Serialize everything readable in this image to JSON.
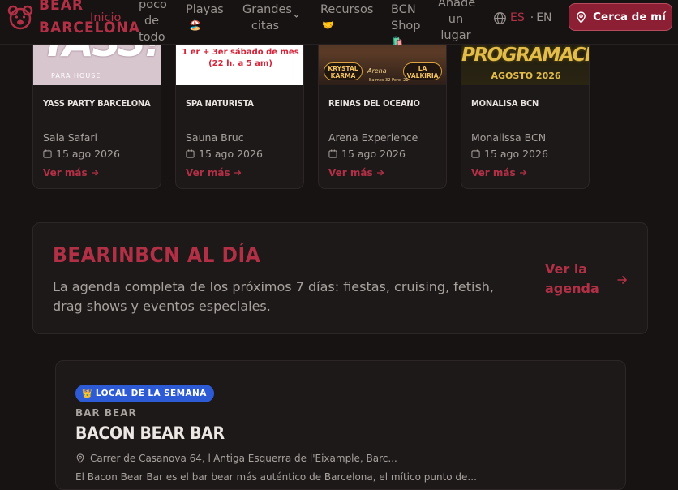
{
  "header": {
    "logo_text_line1": "BEAR",
    "logo_text_line2": "BARCELONA",
    "nav": {
      "inicio": "Inicio",
      "poco_line1": "poco",
      "poco_line2": "de",
      "poco_line3": "todo",
      "playas": "Playas",
      "playas_emoji": "🏖️",
      "grandes_line1": "Grandes",
      "grandes_line2": "citas",
      "recursos": "Recursos",
      "recursos_emoji": "🤝",
      "bcn_shop_line1": "BCN",
      "bcn_shop_line2": "Shop",
      "bcn_shop_emoji": "🛍️",
      "anade_line1": "Añade",
      "anade_line2": "un",
      "anade_line3": "lugar"
    },
    "lang_es": "ES",
    "lang_sep": "·",
    "lang_en": "EN",
    "near_me": "Cerca de mí"
  },
  "cards": [
    {
      "title": "YASS PARTY BARCELONA",
      "venue": "Sala Safari",
      "date": "15 ago 2026",
      "link": "Ver más",
      "img_big": "YASS!",
      "img_small": "PARA HOUSE"
    },
    {
      "title": "SPA NATURISTA",
      "venue": "Sauna Bruc",
      "date": "15 ago 2026",
      "link": "Ver más",
      "img_line1": "1 er + 3er sábado de mes",
      "img_line2": "(22 h. a 5 am)"
    },
    {
      "title": "REINAS DEL OCEANO",
      "venue": "Arena Experience",
      "date": "15 ago 2026",
      "link": "Ver más",
      "img_left": "KRYSTAL KARMA",
      "img_right": "LA VALKIRIA",
      "img_mid": "Arena",
      "img_addr": "Balmes 32 Pere, 21"
    },
    {
      "title": "MONALISA BCN",
      "venue": "Monalissa BCN",
      "date": "15 ago 2026",
      "link": "Ver más",
      "img_line1": "PROGRAMACIÓN",
      "img_line2": "AGOSTO 2026"
    }
  ],
  "agenda": {
    "title": "BEARINBCN AL DÍA",
    "description": "La agenda completa de los próximos 7 días: fiestas, cruising, fetish, drag shows y eventos especiales.",
    "link": "Ver la agenda"
  },
  "local": {
    "badge": "LOCAL DE LA SEMANA",
    "badge_emoji": "👑",
    "category": "BAR BEAR",
    "name": "BACON BEAR BAR",
    "address": "Carrer de Casanova 64, l'Antiga Esquerra de l'Eixample, Barc...",
    "description": "El Bacon Bear Bar es el bar bear más auténtico de Barcelona, el mítico punto de..."
  },
  "colors": {
    "background": "#161312",
    "accent": "#b23046",
    "card": "#1d1918",
    "badge_blue": "#2d5bd6"
  }
}
